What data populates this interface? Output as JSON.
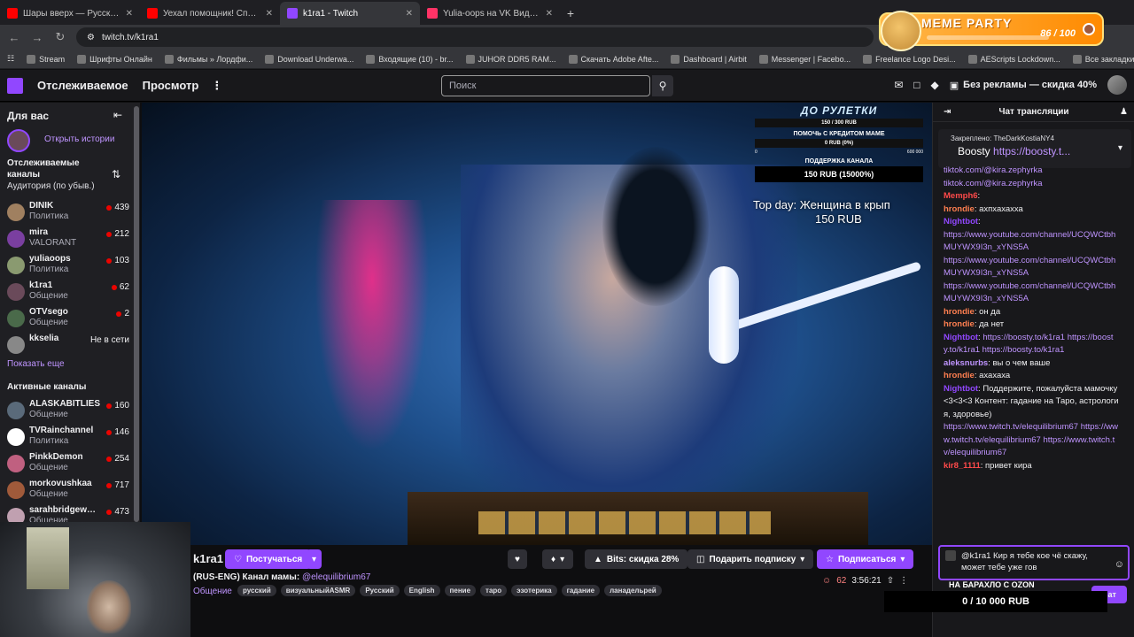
{
  "browser": {
    "tabs": [
      {
        "title": "Шары вверх — Русский трейл",
        "color": "#ff0000"
      },
      {
        "title": "Уехал помощник! Справляем",
        "color": "#ff0000"
      },
      {
        "title": "k1ra1 - Twitch",
        "color": "#9147ff"
      },
      {
        "title": "Yulia-oops на VK Видео Live",
        "color": "#ff3366"
      }
    ],
    "url": "twitch.tv/k1ra1",
    "bookmarks": [
      "Stream",
      "Шрифты Онлайн",
      "Фильмы » Лордфи...",
      "Download Underwa...",
      "Входящие (10) - br...",
      "JUHOR DDR5 RAM...",
      "Скачать Adobe Afte...",
      "Dashboard | Airbit",
      "Messenger | Facebo...",
      "Freelance Logo Desi...",
      "AEScripts Lockdown...",
      "Все закладки"
    ]
  },
  "meme": {
    "title": "MEME PARTY",
    "count": "86 / 100"
  },
  "nav": {
    "following": "Отслеживаемое",
    "browse": "Просмотр",
    "search_placeholder": "Поиск",
    "promo": "Без рекламы — скидка 40%"
  },
  "sidebar": {
    "for_you": "Для вас",
    "open_stories": "Открыть истории",
    "followed_title": "Отслеживаемые каналы",
    "sort": "Аудитория (по убыв.)",
    "followed": [
      {
        "name": "DINIK",
        "game": "Политика",
        "viewers": "439",
        "color": "#a08060"
      },
      {
        "name": "mira",
        "game": "VALORANT",
        "viewers": "212",
        "color": "#7a3fa0"
      },
      {
        "name": "yuliaoops",
        "game": "Политика",
        "viewers": "103",
        "color": "#8a9a70"
      },
      {
        "name": "k1ra1",
        "game": "Общение",
        "viewers": "62",
        "color": "#6a4a5a"
      },
      {
        "name": "OTVsego",
        "game": "Общение",
        "viewers": "2",
        "color": "#4a6a4a"
      },
      {
        "name": "kkselia",
        "game": "",
        "viewers": "Не в сети",
        "color": "#888888"
      }
    ],
    "show_more": "Показать еще",
    "active_title": "Активные каналы",
    "active": [
      {
        "name": "ALASKABITLIES",
        "game": "Общение",
        "viewers": "160",
        "color": "#5a6a7a"
      },
      {
        "name": "TVRainchannel",
        "game": "Политика",
        "viewers": "146",
        "color": "#ffffff"
      },
      {
        "name": "PinkkDemon",
        "game": "Общение",
        "viewers": "254",
        "color": "#c06080"
      },
      {
        "name": "morkovushkaa",
        "game": "Общение",
        "viewers": "717",
        "color": "#a05a3a"
      },
      {
        "name": "sarahbridgewat...",
        "game": "Общение",
        "viewers": "473",
        "color": "#c0a0b0"
      }
    ]
  },
  "overlay": {
    "roulette": "ДО РУЛЕТКИ",
    "roulette_bar": "150 / 300 RUB",
    "credit_label": "ПОМОЧЬ С КРЕДИТОМ МАМЕ",
    "credit_bar": "0 RUB (0%)",
    "range_min": "0",
    "range_max": "600 000",
    "support_label": "ПОДДЕРЖКА КАНАЛА",
    "support_bar": "150 RUB (15000%)",
    "top_day_1": "Top day: Женщина в крып",
    "top_day_2": "150 RUB"
  },
  "channel": {
    "name": "k1ra1",
    "follow": "Постучаться",
    "bits": "Bits: скидка 28%",
    "gift": "Подарить подписку",
    "subscribe": "Подписаться",
    "title": "(RUS-ENG) Канал мамы:",
    "mention": "@elequilibrium67",
    "category": "Общение",
    "tags": [
      "русский",
      "визуальныйASMR",
      "Русский",
      "English",
      "пение",
      "таро",
      "эзотерика",
      "гадание",
      "ланадельрей"
    ],
    "viewers": "62",
    "uptime": "3:56:21"
  },
  "chat": {
    "header": "Чат трансляции",
    "pinned_label": "Закреплено:",
    "pinned_user": "TheDarkKostiaNY4",
    "pinned_text": "Boosty",
    "pinned_link": "https://boosty.t...",
    "messages": [
      {
        "user": "",
        "color": "#efeff1",
        "text": "tiktok.com/@kira.zephyrka",
        "link": true
      },
      {
        "user": "",
        "color": "#efeff1",
        "text": "tiktok.com/@kira.zephyrka",
        "link": true
      },
      {
        "user": "Memph6",
        "color": "#ff4a4a",
        "text": "",
        "link": false
      },
      {
        "user": "hrondie",
        "color": "#ff7f50",
        "text": "ахпхахахха",
        "link": false
      },
      {
        "user": "Nightbot",
        "color": "#9147ff",
        "text": "",
        "link": false
      },
      {
        "user": "",
        "color": "#efeff1",
        "text": "https://www.youtube.com/channel/UCQWCtbhMUYWX9I3n_xYNS5A",
        "link": true
      },
      {
        "user": "",
        "color": "#efeff1",
        "text": "https://www.youtube.com/channel/UCQWCtbhMUYWX9I3n_xYNS5A",
        "link": true
      },
      {
        "user": "",
        "color": "#efeff1",
        "text": "https://www.youtube.com/channel/UCQWCtbhMUYWX9I3n_xYNS5A",
        "link": true
      },
      {
        "user": "hrondie",
        "color": "#ff7f50",
        "text": "он да",
        "link": false
      },
      {
        "user": "hrondie",
        "color": "#ff7f50",
        "text": "да нет",
        "link": false
      },
      {
        "user": "Nightbot",
        "color": "#9147ff",
        "text": "https://boosty.to/k1ra1 https://boosty.to/k1ra1 https://boosty.to/k1ra1",
        "link": true
      },
      {
        "user": "aleksnurbs",
        "color": "#bf94ff",
        "text": "вы о чем ваше",
        "link": false
      },
      {
        "user": "hrondie",
        "color": "#ff7f50",
        "text": "ахахаха",
        "link": false
      },
      {
        "user": "Nightbot",
        "color": "#9147ff",
        "text": "Поддержите, пожалуйста мамочку <3<3<3 Контент: гадание на Таро, астрология, здоровье)",
        "link": false
      },
      {
        "user": "",
        "color": "#efeff1",
        "text": "https://www.twitch.tv/elequilibrium67 https://www.twitch.tv/elequilibrium67 https://www.twitch.tv/elequilibrium67",
        "link": true
      },
      {
        "user": "kir8_1111",
        "color": "#ff4a4a",
        "text": "привет кира",
        "link": false
      }
    ],
    "input_value": "@k1ra1 Кир я тебе кое чё скажу, может тебе уже гов",
    "ozon": "НА БАРАХЛО С OZON",
    "chat_button": "Чат"
  },
  "donation_bar": "0 / 10 000 RUB"
}
